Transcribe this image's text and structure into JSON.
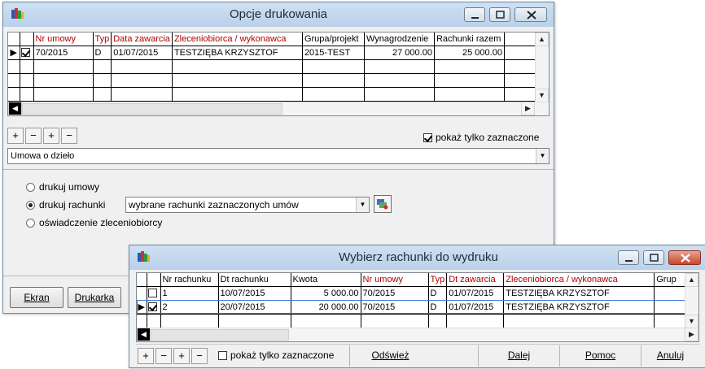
{
  "back_window": {
    "title": "Opcje drukowania",
    "columns": [
      "Nr umowy",
      "Typ",
      "Data zawarcia",
      "Zleceniobiorca / wykonawca",
      "Grupa/projekt",
      "Wynagrodzenie",
      "Rachunki razem"
    ],
    "rows": [
      {
        "selected": true,
        "checked": true,
        "nr": "70/2015",
        "typ": "D",
        "data": "01/07/2015",
        "zleceniobiorca": "TESTZIĘBA KRZYSZTOF",
        "grupa": "2015-TEST",
        "wynagrodzenie": "27 000.00",
        "rachunki": "25 000.00"
      }
    ],
    "nav_buttons": [
      "+",
      "−",
      "+",
      "−"
    ],
    "show_only_checked_label": "pokaż tylko zaznaczone",
    "show_only_checked": true,
    "document_type": "Umowa o dzieło",
    "radio_options": [
      {
        "label": "drukuj umowy",
        "checked": false
      },
      {
        "label": "drukuj rachunki",
        "checked": true
      },
      {
        "label": "oświadczenie zleceniobiorcy",
        "checked": false
      }
    ],
    "bills_selector": "wybrane rachunki zaznaczonych  umów",
    "screen_button": "Ekran",
    "printer_button": "Drukarka"
  },
  "front_window": {
    "title": "Wybierz rachunki do wydruku",
    "columns": [
      "Nr rachunku",
      "Dt rachunku",
      "Kwota",
      "Nr umowy",
      "Typ",
      "Dt zawarcia",
      "Zleceniobiorca / wykonawca",
      "Grup"
    ],
    "rows": [
      {
        "selected": false,
        "checked": false,
        "nr": "1",
        "dt": "10/07/2015",
        "kwota": "5 000.00",
        "umowa": "70/2015",
        "typ": "D",
        "zawarcia": "01/07/2015",
        "zleceniobiorca": "TESTZIĘBA KRZYSZTOF"
      },
      {
        "selected": true,
        "checked": true,
        "nr": "2",
        "dt": "20/07/2015",
        "kwota": "20 000.00",
        "umowa": "70/2015",
        "typ": "D",
        "zawarcia": "01/07/2015",
        "zleceniobiorca": "TESTZIĘBA KRZYSZTOF"
      }
    ],
    "nav_buttons": [
      "+",
      "−",
      "+",
      "−"
    ],
    "show_only_checked_label": "pokaż tylko zaznaczone",
    "show_only_checked": false,
    "refresh_button": "Odśwież",
    "next_button": "Dalej",
    "help_button": "Pomoc",
    "cancel_button": "Anuluj"
  },
  "colors": {
    "title_bar": "#c4d8ee",
    "red_header": "#b00000",
    "close_button": "#c7452b"
  }
}
